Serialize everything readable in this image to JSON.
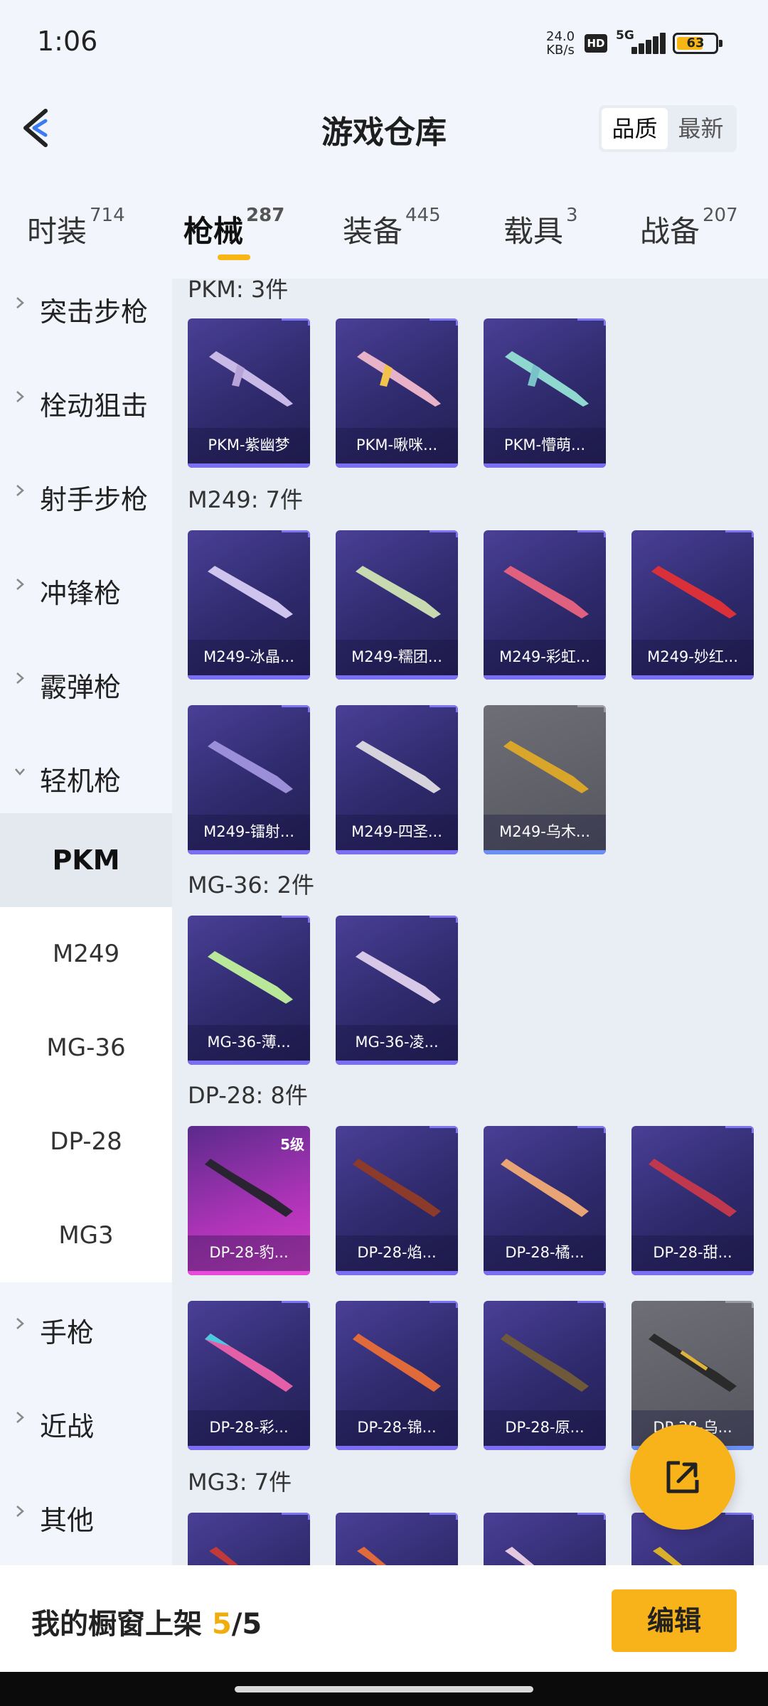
{
  "status_bar": {
    "time": "1:06",
    "net_speed": "24.0",
    "net_unit": "KB/s",
    "hd": "HD",
    "network": "5G",
    "battery": "63"
  },
  "header": {
    "title": "游戏仓库",
    "sort_quality": "品质",
    "sort_latest": "最新"
  },
  "tabs": [
    {
      "label": "时装",
      "count": "714"
    },
    {
      "label": "枪械",
      "count": "287"
    },
    {
      "label": "装备",
      "count": "445"
    },
    {
      "label": "载具",
      "count": "3"
    },
    {
      "label": "战备",
      "count": "207"
    }
  ],
  "sidebar": {
    "categories": [
      "突击步枪",
      "栓动狙击",
      "射手步枪",
      "冲锋枪",
      "霰弹枪",
      "轻机枪"
    ],
    "sub": [
      "PKM",
      "M249",
      "MG-36",
      "DP-28",
      "MG3"
    ],
    "more": [
      "手枪",
      "近战",
      "其他"
    ]
  },
  "sections": [
    {
      "title": "PKM: 3件",
      "items": [
        "PKM-紫幽梦",
        "PKM-啾咪...",
        "PKM-懵萌..."
      ]
    },
    {
      "title": "M249: 7件",
      "items": [
        "M249-冰晶...",
        "M249-糯团...",
        "M249-彩虹...",
        "M249-妙红...",
        "M249-镭射...",
        "M249-四圣...",
        "M249-乌木..."
      ]
    },
    {
      "title": "MG-36: 2件",
      "items": [
        "MG-36-薄...",
        "MG-36-凌..."
      ]
    },
    {
      "title": "DP-28: 8件",
      "items": [
        "DP-28-豹...",
        "DP-28-焰...",
        "DP-28-橘...",
        "DP-28-甜...",
        "DP-28-彩...",
        "DP-28-锦...",
        "DP-28-原...",
        "DP-28-乌..."
      ],
      "level_badge": "5级"
    },
    {
      "title": "MG3: 7件"
    }
  ],
  "bottom_bar": {
    "label": "我的橱窗上架",
    "count": "5",
    "total": "/5",
    "edit_label": "编辑"
  },
  "colors": {
    "accent": "#f8b31a",
    "card_purple": "#2e2a6c",
    "card_grey": "#55565d",
    "card_pink": "#d43fc7"
  }
}
